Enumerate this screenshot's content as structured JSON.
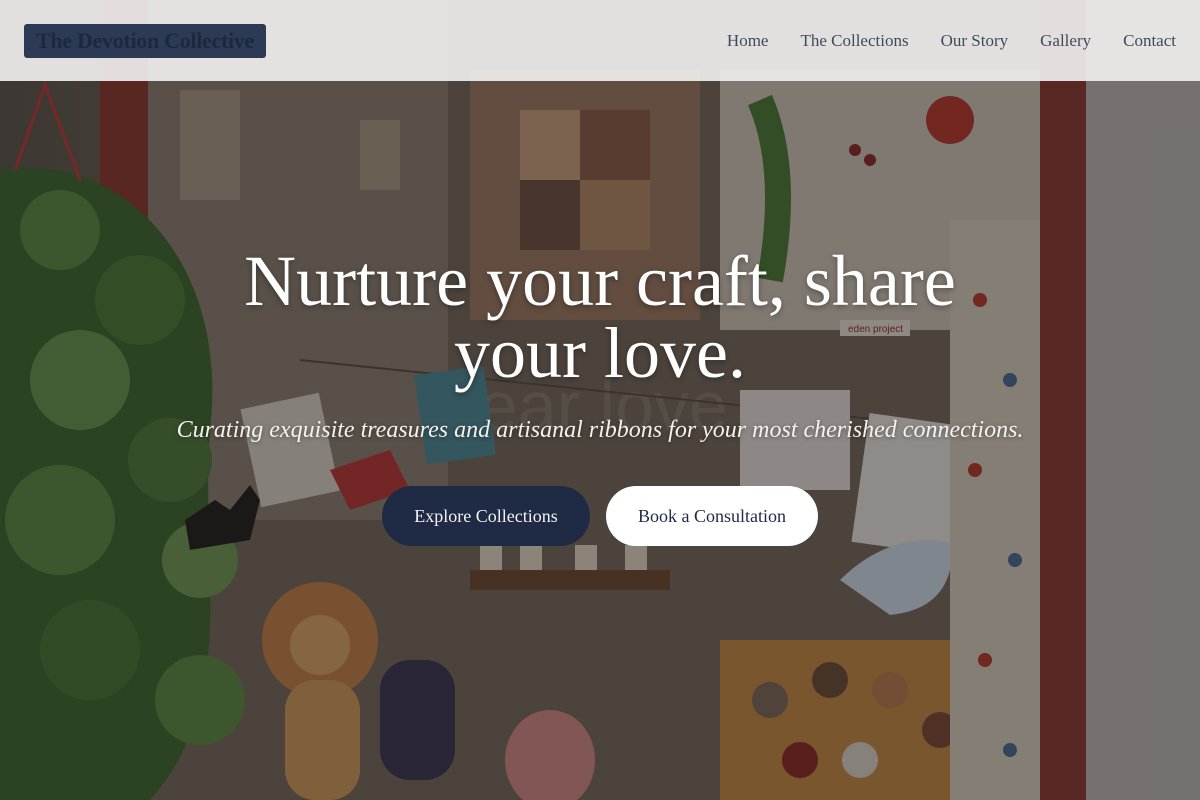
{
  "brand": {
    "name": "The Devotion Collective"
  },
  "nav": {
    "items": [
      {
        "label": "Home"
      },
      {
        "label": "The Collections"
      },
      {
        "label": "Our Story"
      },
      {
        "label": "Gallery"
      },
      {
        "label": "Contact"
      }
    ]
  },
  "hero": {
    "headline": "Nurture your craft, share your love.",
    "subheadline": "Curating exquisite treasures and artisanal ribbons for your most cherished connections.",
    "primary_cta": "Explore Collections",
    "secondary_cta": "Book a Consultation"
  },
  "scene": {
    "window_signs": [
      "eden project",
      "dear love"
    ]
  },
  "colors": {
    "brand_navy": "#1f2a44",
    "header_bg": "#eeedec",
    "nav_text": "#3e4a5c",
    "white": "#ffffff"
  }
}
